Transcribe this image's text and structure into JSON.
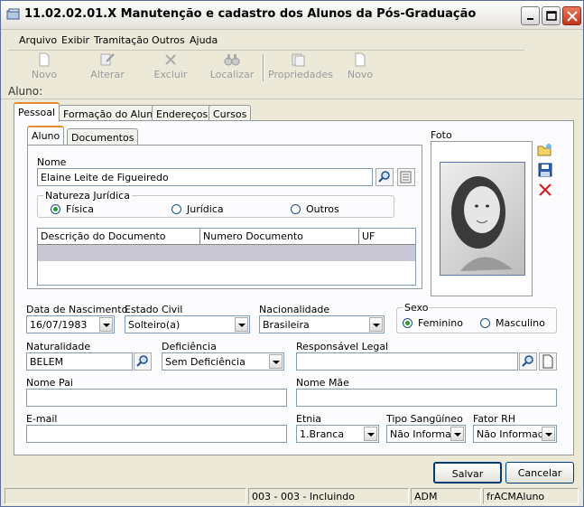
{
  "window": {
    "title": "11.02.02.01.X Manutenção e cadastro dos Alunos da Pós-Graduação"
  },
  "menu": [
    "Arquivo",
    "Exibir",
    "Tramitação",
    "Outros",
    "Ajuda"
  ],
  "toolbar": [
    "Novo",
    "Alterar",
    "Excluir",
    "Localizar",
    "Propriedades",
    "Novo"
  ],
  "section_label": "Aluno:",
  "main_tabs": [
    "Pessoal",
    "Formação do Aluno",
    "Endereços",
    "Cursos"
  ],
  "sub_tabs": [
    "Aluno",
    "Documentos"
  ],
  "nome": {
    "label": "Nome",
    "value": "Elaine Leite de Figueiredo"
  },
  "natureza": {
    "legend": "Natureza Jurídica",
    "options": [
      "Física",
      "Jurídica",
      "Outros"
    ],
    "selected": "Física"
  },
  "documents_table": {
    "columns": [
      "Descrição do Documento",
      "Numero Documento",
      "UF"
    ]
  },
  "foto": {
    "label": "Foto"
  },
  "data_nascimento": {
    "label": "Data de Nascimento",
    "value": "16/07/1983"
  },
  "estado_civil": {
    "label": "Estado Civil",
    "value": "Solteiro(a)"
  },
  "nacionalidade": {
    "label": "Nacionalidade",
    "value": "Brasileira"
  },
  "sexo": {
    "legend": "Sexo",
    "options": [
      "Feminino",
      "Masculino"
    ],
    "selected": "Feminino"
  },
  "naturalidade": {
    "label": "Naturalidade",
    "value": "BELEM"
  },
  "deficiencia": {
    "label": "Deficiência",
    "value": "Sem Deficiência"
  },
  "responsavel": {
    "label": "Responsável Legal",
    "value": ""
  },
  "nome_pai": {
    "label": "Nome Pai",
    "value": ""
  },
  "nome_mae": {
    "label": "Nome Mãe",
    "value": ""
  },
  "email": {
    "label": "E-mail",
    "value": ""
  },
  "etnia": {
    "label": "Etnia",
    "value": "1.Branca"
  },
  "tipo_sanguineo": {
    "label": "Tipo Sangüíneo",
    "value": "Não Informad"
  },
  "fator_rh": {
    "label": "Fator RH",
    "value": "Não Informado"
  },
  "buttons": {
    "save": "Salvar",
    "cancel": "Cancelar"
  },
  "status": [
    "",
    "003 - 003 - Incluindo",
    "ADM",
    "frACMAluno"
  ]
}
